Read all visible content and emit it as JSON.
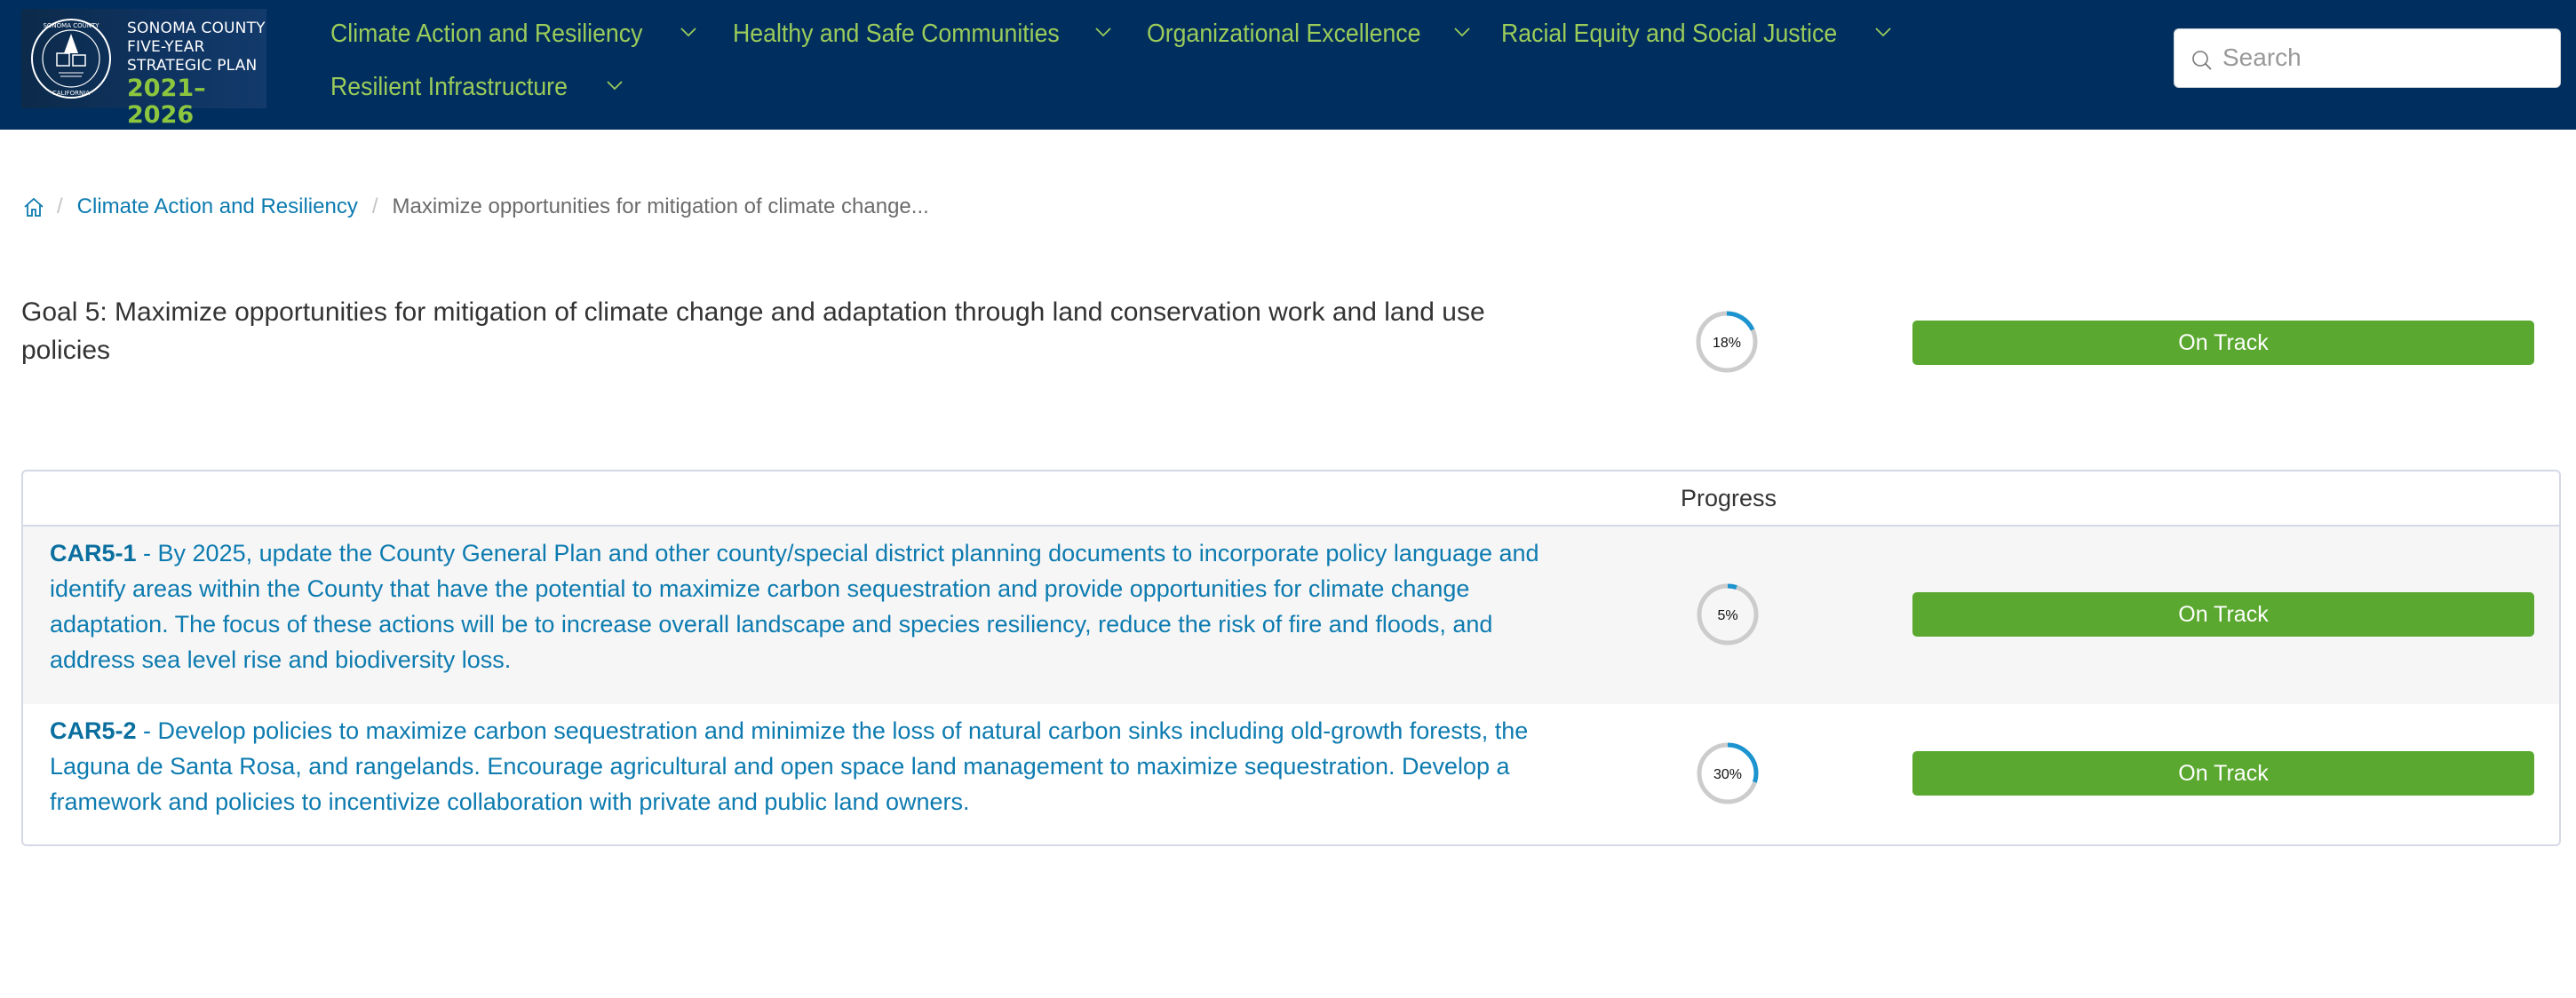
{
  "header": {
    "logo": {
      "line1": "SONOMA COUNTY",
      "line2": "FIVE-YEAR",
      "line3": "STRATEGIC PLAN",
      "years": "2021–2026"
    },
    "nav": [
      {
        "label": "Climate Action and Resiliency"
      },
      {
        "label": "Healthy and Safe Communities"
      },
      {
        "label": "Organizational Excellence"
      },
      {
        "label": "Racial Equity and Social Justice"
      },
      {
        "label": "Resilient Infrastructure"
      }
    ],
    "search": {
      "placeholder": "Search",
      "value": ""
    }
  },
  "breadcrumb": {
    "home_icon": "home-icon",
    "items": [
      {
        "label": "Climate Action and Resiliency"
      },
      {
        "label": "Maximize opportunities for mitigation of climate change..."
      }
    ],
    "separator": "/"
  },
  "goal": {
    "title": "Goal 5: Maximize opportunities for mitigation of climate change and adaptation through land conservation work and land use policies",
    "progress_percent": 18,
    "progress_label": "18%",
    "status": "On Track"
  },
  "table": {
    "header_progress": "Progress",
    "rows": [
      {
        "code": "CAR5-1",
        "separator": " - ",
        "text": "By 2025, update the County General Plan and other county/special district planning documents to incorporate policy language and identify areas within the County that have the potential to maximize carbon sequestration and provide opportunities for climate change adaptation. The focus of these actions will be to increase overall landscape and species resiliency, reduce the risk of fire and floods, and address sea level rise and biodiversity loss.",
        "progress_percent": 5,
        "progress_label": "5%",
        "status": "On Track"
      },
      {
        "code": "CAR5-2",
        "separator": " - ",
        "text": "Develop policies to maximize carbon sequestration and minimize the loss of natural carbon sinks including old-growth forests, the Laguna de Santa Rosa, and rangelands. Encourage agricultural and open space land management to maximize sequestration. Develop a framework and policies to incentivize collaboration with private and public land owners.",
        "progress_percent": 30,
        "progress_label": "30%",
        "status": "On Track"
      }
    ]
  },
  "colors": {
    "header_bg": "#002f5f",
    "nav_text": "#9bcb5a",
    "link": "#0d7bb0",
    "status_on_track": "#5aa82f",
    "progress_fill": "#1b94d0",
    "progress_track": "#cccccc"
  }
}
